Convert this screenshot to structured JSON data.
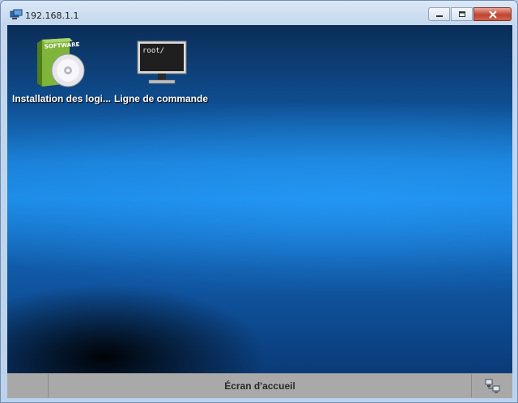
{
  "window": {
    "title": "192.168.1.1"
  },
  "titlebar_buttons": {
    "minimize": "minimize-icon",
    "maximize": "maximize-icon",
    "close": "close-icon"
  },
  "desktop": {
    "icons": [
      {
        "label": "Installation des logi...",
        "icon": "software-install-icon",
        "box_text": "SOFTWARE"
      },
      {
        "label": "Ligne de commande",
        "icon": "terminal-monitor-icon",
        "screen_text": "root/"
      }
    ]
  },
  "statusbar": {
    "home_label": "Écran d'accueil",
    "network_icon": "network-icon"
  }
}
